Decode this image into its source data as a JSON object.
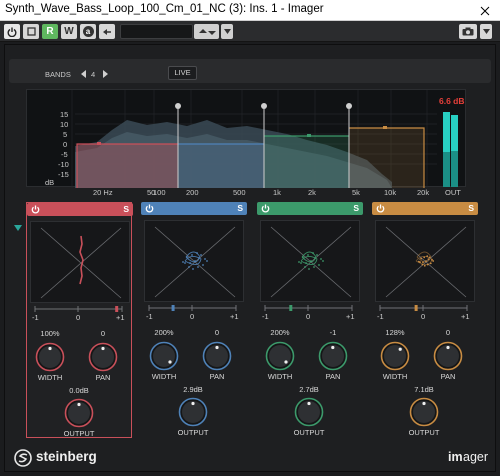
{
  "window": {
    "title": "Synth_Wave_Bass_Loop_100_Cm_01_NC (3): Ins. 1 - Imager"
  },
  "toolbar": {
    "read": "R",
    "write": "W",
    "a": "a"
  },
  "header": {
    "bands_label": "BANDS",
    "bands_value": "4",
    "live_label": "LIVE"
  },
  "spectrum": {
    "ylabels": [
      "15",
      "10",
      "5",
      "0",
      "-5",
      "-10",
      "-15"
    ],
    "db_unit": "dB",
    "xlabels": [
      "20 Hz",
      "50",
      "100",
      "200",
      "500",
      "1k",
      "2k",
      "5k",
      "10k",
      "20k"
    ],
    "out_label": "OUT",
    "peak_db": "6.6 dB"
  },
  "colors": {
    "band1": "#c9505a",
    "band2": "#4f82b8",
    "band3": "#3c9a6b",
    "band4": "#c88c43",
    "meter": "#22c1b4",
    "peak": "#e8403a"
  },
  "bands": [
    {
      "scope_left": "-1",
      "scope_mid": "0",
      "scope_right": "+1",
      "width_value": "100%",
      "width_label": "WIDTH",
      "pan_value": "0",
      "pan_label": "PAN",
      "output_value": "0.0dB",
      "output_label": "OUTPUT",
      "solo": "S",
      "width_pct": 100,
      "pan": 0,
      "pan_marker": 0.95
    },
    {
      "scope_left": "-1",
      "scope_mid": "0",
      "scope_right": "+1",
      "width_value": "200%",
      "width_label": "WIDTH",
      "pan_value": "0",
      "pan_label": "PAN",
      "output_value": "2.9dB",
      "output_label": "OUTPUT",
      "solo": "S",
      "width_pct": 200,
      "pan": 0,
      "pan_marker": 0.28
    },
    {
      "scope_left": "-1",
      "scope_mid": "0",
      "scope_right": "+1",
      "width_value": "200%",
      "width_label": "WIDTH",
      "pan_value": "-1",
      "pan_label": "PAN",
      "output_value": "2.7dB",
      "output_label": "OUTPUT",
      "solo": "S",
      "width_pct": 200,
      "pan": -1,
      "pan_marker": 0.3
    },
    {
      "scope_left": "-1",
      "scope_mid": "0",
      "scope_right": "+1",
      "width_value": "128%",
      "width_label": "WIDTH",
      "pan_value": "0",
      "pan_label": "PAN",
      "output_value": "7.1dB",
      "output_label": "OUTPUT",
      "solo": "S",
      "width_pct": 128,
      "pan": 0,
      "pan_marker": 0.42
    }
  ],
  "footer": {
    "brand": "steinberg",
    "product_pre": "im",
    "product_post": "ager"
  }
}
